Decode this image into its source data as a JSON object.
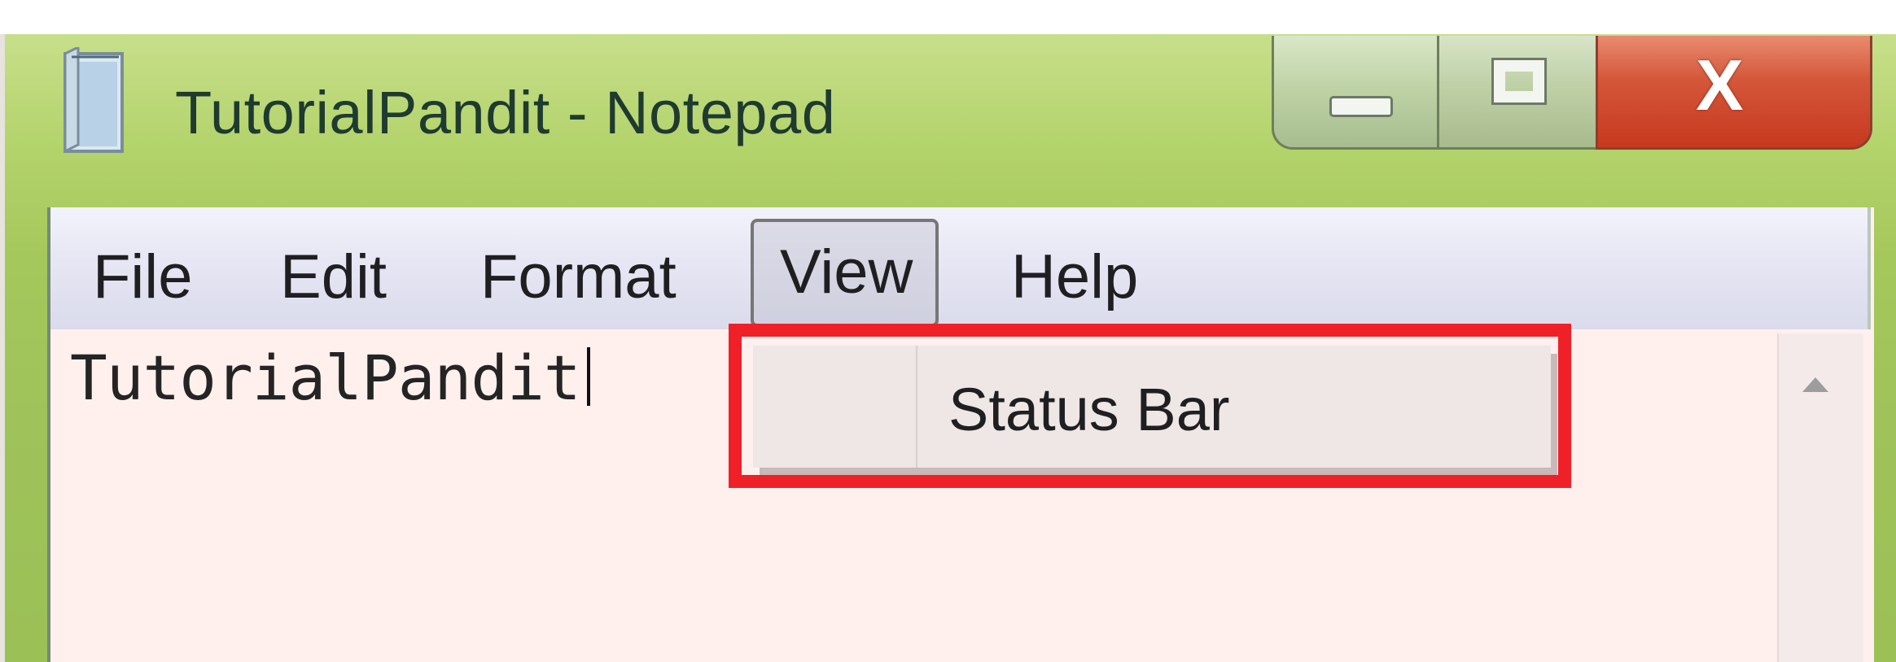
{
  "window": {
    "title": "TutorialPandit - Notepad"
  },
  "menu": {
    "file": "File",
    "edit": "Edit",
    "format": "Format",
    "view": "View",
    "help": "Help"
  },
  "document": {
    "text": "TutorialPandit"
  },
  "view_menu": {
    "items": [
      {
        "label": "Status Bar",
        "checked": false
      }
    ]
  },
  "icons": {
    "app": "notepad-icon",
    "minimize": "minimize-icon",
    "maximize": "maximize-icon",
    "close": "close-icon",
    "scroll_up": "scroll-up-arrow-icon"
  },
  "colors": {
    "highlight": "#ef2028",
    "close_button": "#d45639"
  }
}
